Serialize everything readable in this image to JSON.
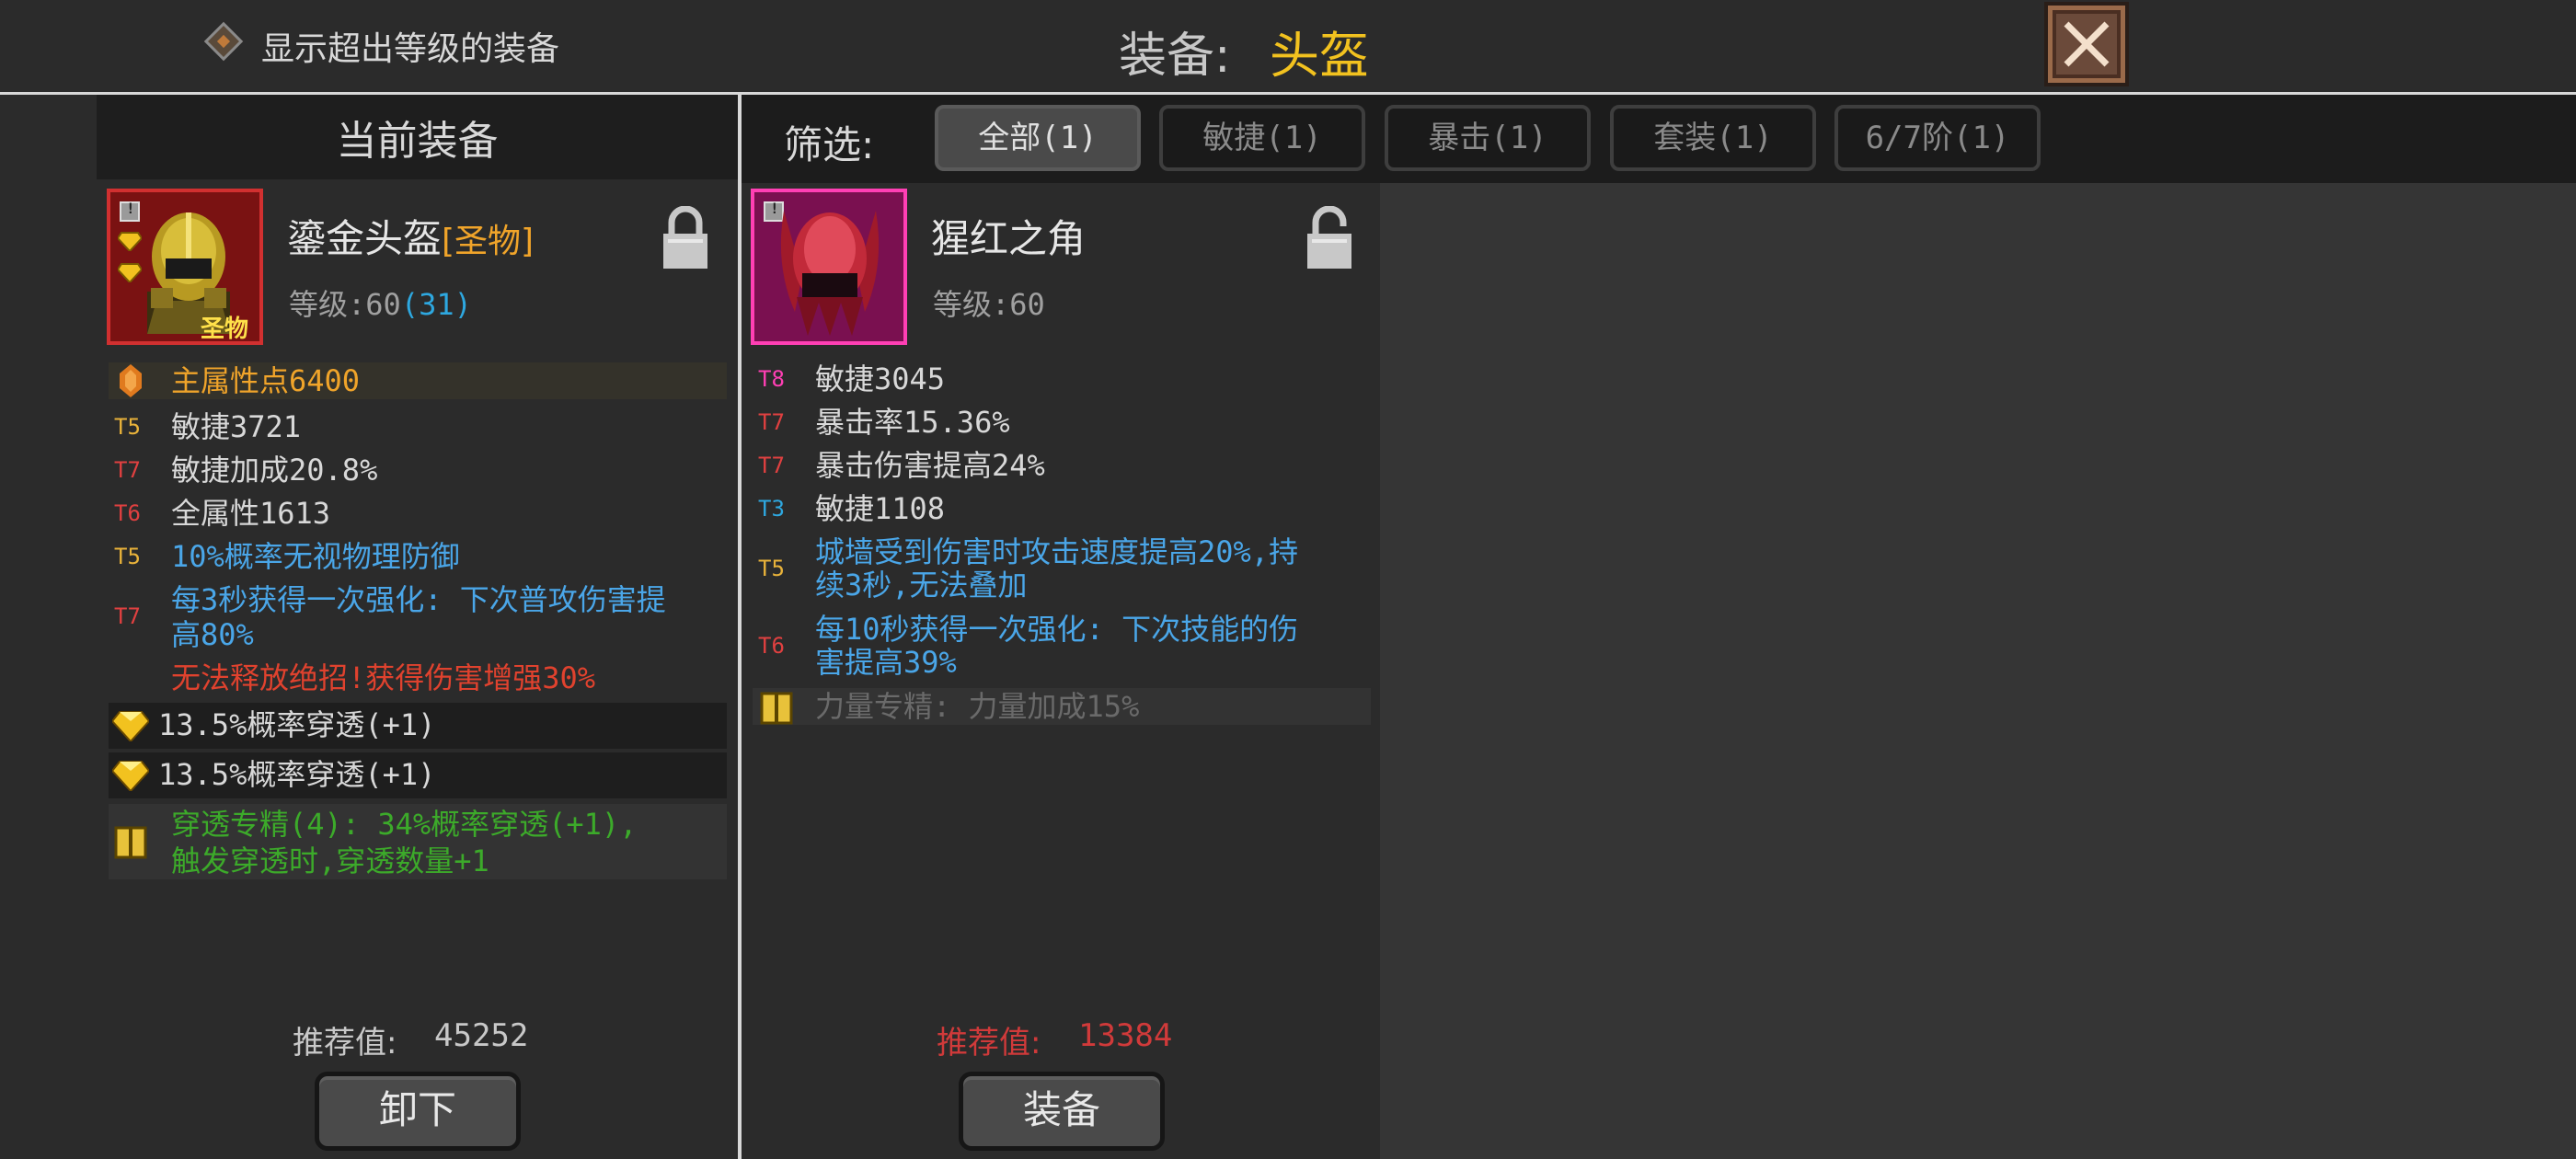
{
  "topbar": {
    "toggle_label": "显示超出等级的装备",
    "title_prefix": "装备:",
    "title_value": "头盔"
  },
  "left": {
    "title": "当前装备",
    "item": {
      "name": "鎏金头盔",
      "tag": "[圣物]",
      "level_label": "等级:60",
      "level_extra": "(31)",
      "icon_caption": "圣物",
      "locked": true
    },
    "main_stat": "主属性点6400",
    "stats": [
      {
        "tier": "T5",
        "text": "敏捷3721"
      },
      {
        "tier": "T7",
        "text": "敏捷加成20.8%"
      },
      {
        "tier": "T6",
        "text": "全属性1613"
      },
      {
        "tier": "T5",
        "text": "10%概率无视物理防御"
      },
      {
        "tier": "T7",
        "text_line1": "每3秒获得一次强化: 下次普攻伤害提",
        "text_line2": "高80%"
      }
    ],
    "warning": "无法释放绝招!获得伤害增强30%",
    "gems": [
      "13.5%概率穿透(+1)",
      "13.5%概率穿透(+1)"
    ],
    "mastery_line1": "穿透专精(4): 34%概率穿透(+1),",
    "mastery_line2": "触发穿透时,穿透数量+1",
    "recommend_label": "推荐值:",
    "recommend_value": "45252",
    "button_label": "卸下"
  },
  "filter": {
    "label": "筛选:",
    "tabs": [
      "全部(1)",
      "敏捷(1)",
      "暴击(1)",
      "套装(1)",
      "6/7阶(1)"
    ],
    "active_index": 0
  },
  "candidate": {
    "item": {
      "name": "猩红之角",
      "level_label": "等级:60",
      "locked": false
    },
    "stats": [
      {
        "tier": "T8",
        "text": "敏捷3045"
      },
      {
        "tier": "T7",
        "text": "暴击率15.36%"
      },
      {
        "tier": "T7",
        "text": "暴击伤害提高24%"
      },
      {
        "tier": "T3",
        "text": "敏捷1108"
      },
      {
        "tier": "T5",
        "text_line1": "城墙受到伤害时攻击速度提高20%,持",
        "text_line2": "续3秒,无法叠加"
      },
      {
        "tier": "T6",
        "text_line1": "每10秒获得一次强化: 下次技能的伤",
        "text_line2": "害提高39%"
      }
    ],
    "mastery": "力量专精: 力量加成15%",
    "recommend_label": "推荐值:",
    "recommend_value": "13384",
    "button_label": "装备"
  },
  "colors": {
    "gold": "#f2c21f",
    "tier_t5": "#e8b23a",
    "tier_t6_t7": "#e04040",
    "tier_t8": "#ff3fb4",
    "tier_t3": "#2ea8e0",
    "affix_blue": "#4aa6e8",
    "warning_red": "#e0422e",
    "mastery_green": "#3caa2a",
    "recommend_red": "#d03a3a"
  },
  "icons": [
    "diamond-toggle-icon",
    "close-x-icon",
    "lock-icon",
    "unlock-icon",
    "gem-icon",
    "book-icon",
    "helmet-icon",
    "horned-helmet-icon"
  ]
}
